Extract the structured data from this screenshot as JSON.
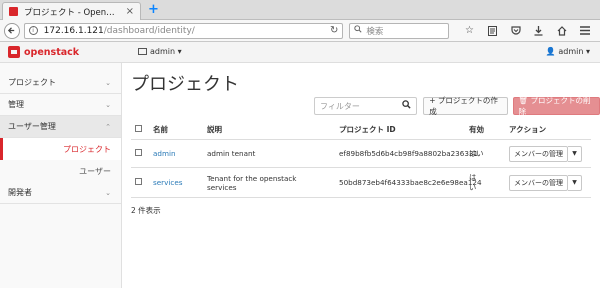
{
  "browser": {
    "tab_title": "プロジェクト - Open…",
    "tab_close": "×",
    "new_tab": "+",
    "back_icon": "back-arrow-icon",
    "url_host": "172.16.1.121",
    "url_path": "/dashboard/identity/",
    "reload": "↻",
    "search_placeholder": "検索",
    "toolbar_icons": [
      "star-icon",
      "reader-icon",
      "pocket-icon",
      "download-icon",
      "home-icon",
      "menu-icon"
    ]
  },
  "app": {
    "logo": "openstack",
    "project": "admin ▾",
    "user": "👤 admin ▾"
  },
  "sidebar": {
    "items": [
      {
        "label": "プロジェクト",
        "chev": "⌄"
      },
      {
        "label": "管理",
        "chev": "⌄"
      },
      {
        "label": "ユーザー管理",
        "chev": "⌃"
      },
      {
        "label": "開発者",
        "chev": "⌄"
      }
    ],
    "sub_items": [
      "プロジェクト",
      "ユーザー"
    ]
  },
  "page": {
    "title": "プロジェクト",
    "filter_placeholder": "フィルター",
    "create_button": "+ プロジェクトの作成",
    "delete_button": "🗑 プロジェクトの削除",
    "count_text": "2 件表示"
  },
  "table": {
    "headers": [
      "名前",
      "説明",
      "プロジェクト ID",
      "有効",
      "アクション"
    ],
    "rows": [
      {
        "name": "admin",
        "desc": "admin tenant",
        "desc2": "",
        "pid": "ef89b8fb5d6b4cb98f9a8802ba236331",
        "enabled": "はい",
        "enabled2": "",
        "action": "メンバーの管理"
      },
      {
        "name": "services",
        "desc": "Tenant for the openstack",
        "desc2": "services",
        "pid": "50bd873eb4f64333bae8c2e6e98ea124",
        "enabled": "は",
        "enabled2": "い",
        "action": "メンバーの管理"
      }
    ]
  },
  "colors": {
    "accent": "#d9262b",
    "link": "#2a7ab7",
    "danger_btn": "#e58f92"
  }
}
